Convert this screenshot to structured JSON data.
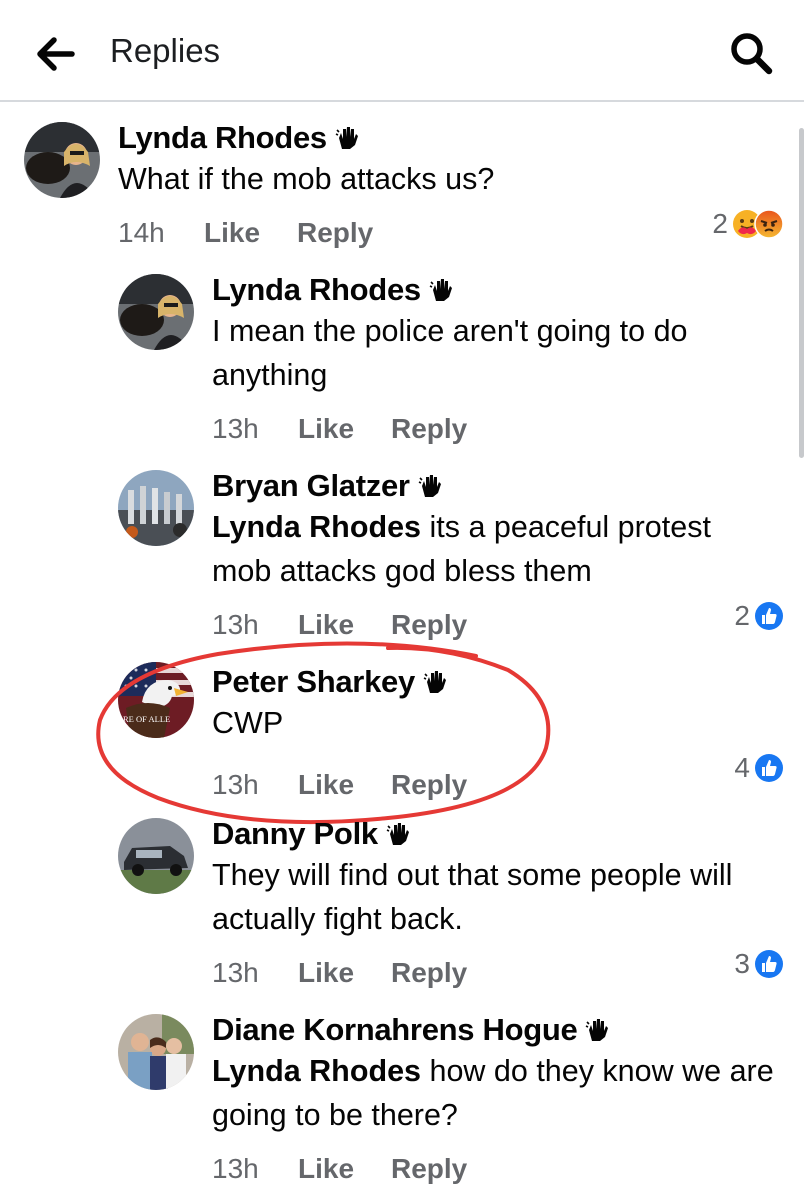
{
  "header": {
    "title": "Replies",
    "back_icon": "arrow-left-icon",
    "search_icon": "search-icon"
  },
  "comments": [
    {
      "author": "Lynda Rhodes",
      "text": "What if the mob attacks us?",
      "time": "14h",
      "like": "Like",
      "reply": "Reply",
      "reaction_count": "2",
      "reactions": [
        "care",
        "angry"
      ]
    },
    {
      "author": "Lynda Rhodes",
      "text": "I mean the police aren't going to do anything",
      "time": "13h",
      "like": "Like",
      "reply": "Reply"
    },
    {
      "author": "Bryan Glatzer",
      "mention": "Lynda Rhodes",
      "text": " its a peaceful protest mob attacks god bless them",
      "time": "13h",
      "like": "Like",
      "reply": "Reply",
      "reaction_count": "2",
      "reactions": [
        "like"
      ]
    },
    {
      "author": "Peter Sharkey",
      "text": "CWP",
      "time": "13h",
      "like": "Like",
      "reply": "Reply",
      "reaction_count": "4",
      "reactions": [
        "like"
      ],
      "circled": true,
      "avatar_text": "RE OF ALLE"
    },
    {
      "author": "Danny Polk",
      "text": "They will find out that some people will actually fight back.",
      "time": "13h",
      "like": "Like",
      "reply": "Reply",
      "reaction_count": "3",
      "reactions": [
        "like"
      ]
    },
    {
      "author": "Diane Kornahrens Hogue",
      "mention": "Lynda Rhodes",
      "text": " how do they know we are going to be there?",
      "time": "13h",
      "like": "Like",
      "reply": "Reply"
    }
  ],
  "colors": {
    "like_blue": "#1877f2",
    "annotation_red": "#e53935",
    "secondary_text": "#65676b"
  }
}
